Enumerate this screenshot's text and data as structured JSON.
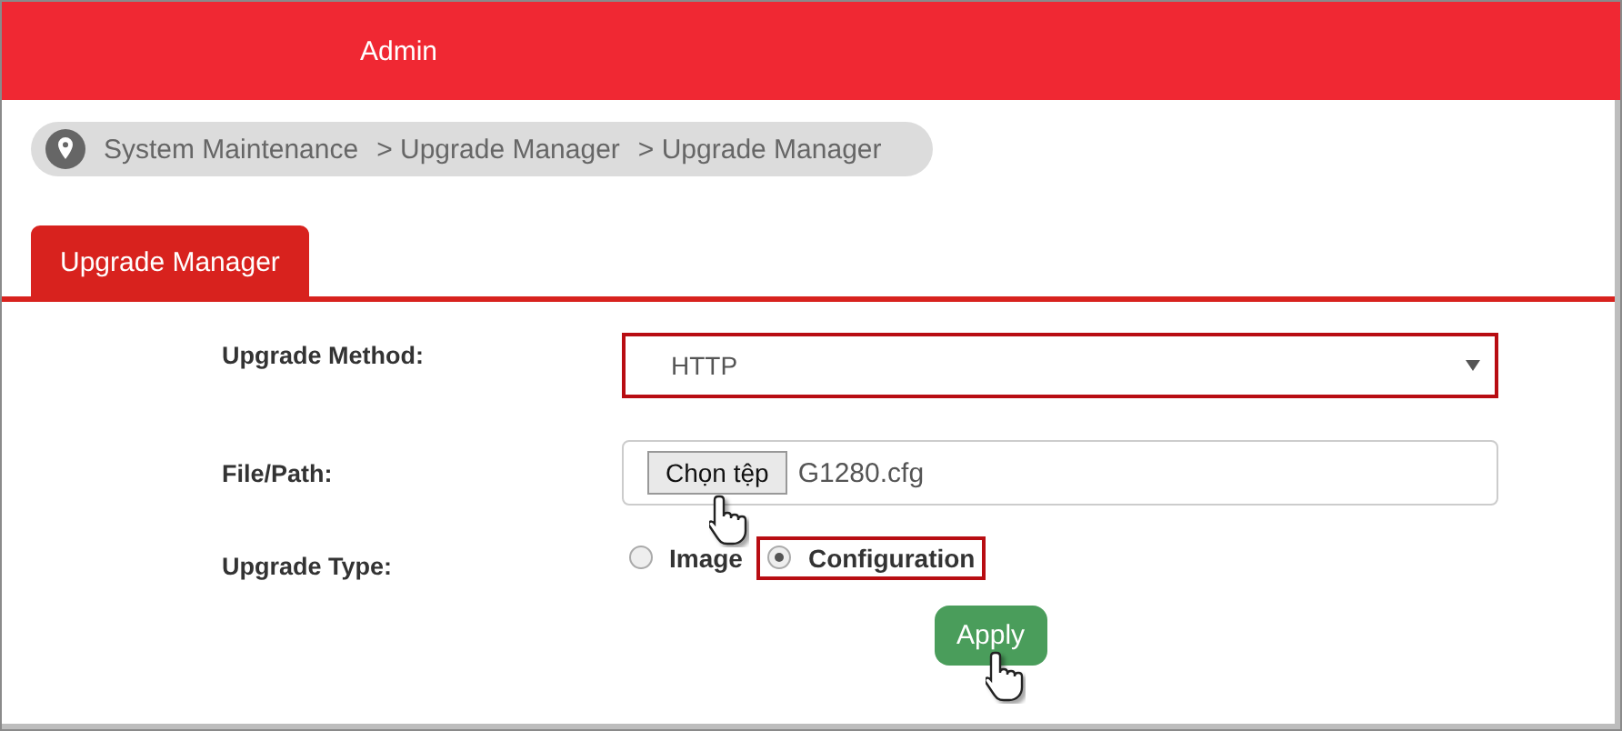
{
  "header": {
    "title": "Admin"
  },
  "breadcrumb": [
    "System Maintenance",
    "> Upgrade Manager",
    "> Upgrade Manager"
  ],
  "tabs": [
    {
      "label": "Upgrade Manager",
      "selected": true
    }
  ],
  "form": {
    "method": {
      "label": "Upgrade Method:",
      "value": "HTTP",
      "highlighted": true
    },
    "file": {
      "label": "File/Path:",
      "button": "Chọn tệp",
      "value": "G1280.cfg",
      "cursor": true
    },
    "type": {
      "label": "Upgrade Type:",
      "options": [
        {
          "label": "Image",
          "selected": false,
          "highlighted": false
        },
        {
          "label": "Configuration",
          "selected": true,
          "highlighted": true
        }
      ]
    }
  },
  "apply": {
    "label": "Apply",
    "cursor": true
  }
}
